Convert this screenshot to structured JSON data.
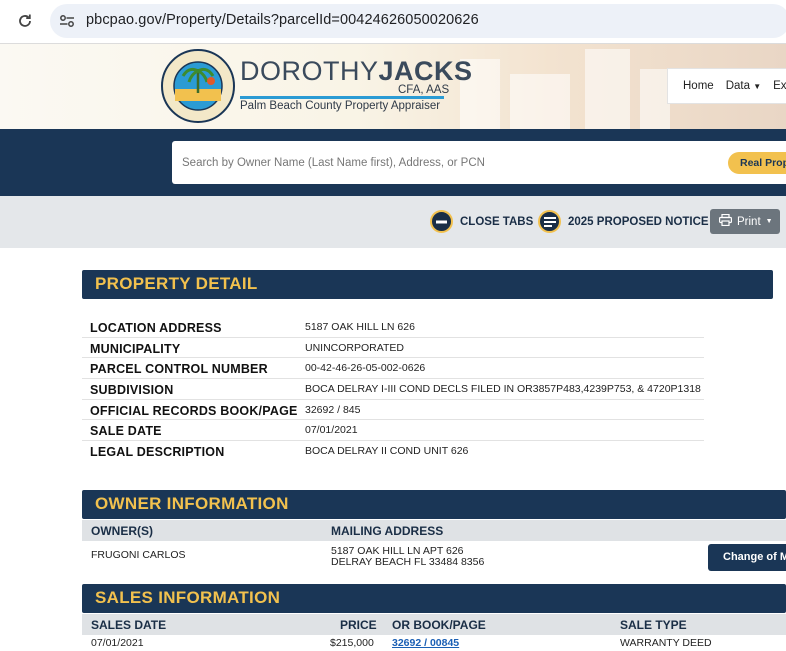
{
  "browser": {
    "url": "pbcpao.gov/Property/Details?parcelId=00424626050020626"
  },
  "header": {
    "seal_text_top": "PALM BEACH COUNTY",
    "seal_text_bottom": "PROPERTY APPRAISER",
    "brand_first": "DOROTHY",
    "brand_last": "JACKS",
    "brand_credentials": "CFA, AAS",
    "brand_subtitle": "Palm Beach County Property Appraiser",
    "nav": [
      "Home",
      "Data",
      "Exe"
    ]
  },
  "search": {
    "placeholder": "Search by Owner Name (Last Name first), Address, or PCN",
    "real_property_button": "Real Prope"
  },
  "toolbar": {
    "close_tabs": "CLOSE TABS",
    "proposed_notice": "2025 PROPOSED NOTICE",
    "print": "Print"
  },
  "property_detail": {
    "title": "PROPERTY DETAIL",
    "rows": [
      {
        "label": "LOCATION ADDRESS",
        "value": "5187 OAK HILL LN 626"
      },
      {
        "label": "MUNICIPALITY",
        "value": "UNINCORPORATED"
      },
      {
        "label": "PARCEL CONTROL NUMBER",
        "value": "00-42-46-26-05-002-0626"
      },
      {
        "label": "SUBDIVISION",
        "value": "BOCA DELRAY I-III COND DECLS FILED IN OR3857P483,4239P753, & 4720P1318"
      },
      {
        "label": "OFFICIAL RECORDS BOOK/PAGE",
        "value": "32692 / 845"
      },
      {
        "label": "SALE DATE",
        "value": "07/01/2021"
      },
      {
        "label": "LEGAL DESCRIPTION",
        "value": "BOCA DELRAY II COND UNIT 626"
      }
    ]
  },
  "owner_information": {
    "title": "OWNER INFORMATION",
    "col_owners": "OWNER(S)",
    "col_mailing": "MAILING ADDRESS",
    "owner": "FRUGONI CARLOS",
    "mailing_line1": "5187 OAK HILL LN APT 626",
    "mailing_line2": "DELRAY BEACH FL 33484 8356",
    "change_button": "Change of M"
  },
  "sales_information": {
    "title": "SALES INFORMATION",
    "col_date": "SALES DATE",
    "col_price": "PRICE",
    "col_book": "OR BOOK/PAGE",
    "col_type": "SALE TYPE",
    "rows": [
      {
        "date": "07/01/2021",
        "price": "$215,000",
        "book_page": "32692 / 00845",
        "type": "WARRANTY DEED"
      }
    ]
  },
  "colors": {
    "navy": "#1a3656",
    "gold": "#f2c14e",
    "link_blue": "#1a5fb4"
  }
}
